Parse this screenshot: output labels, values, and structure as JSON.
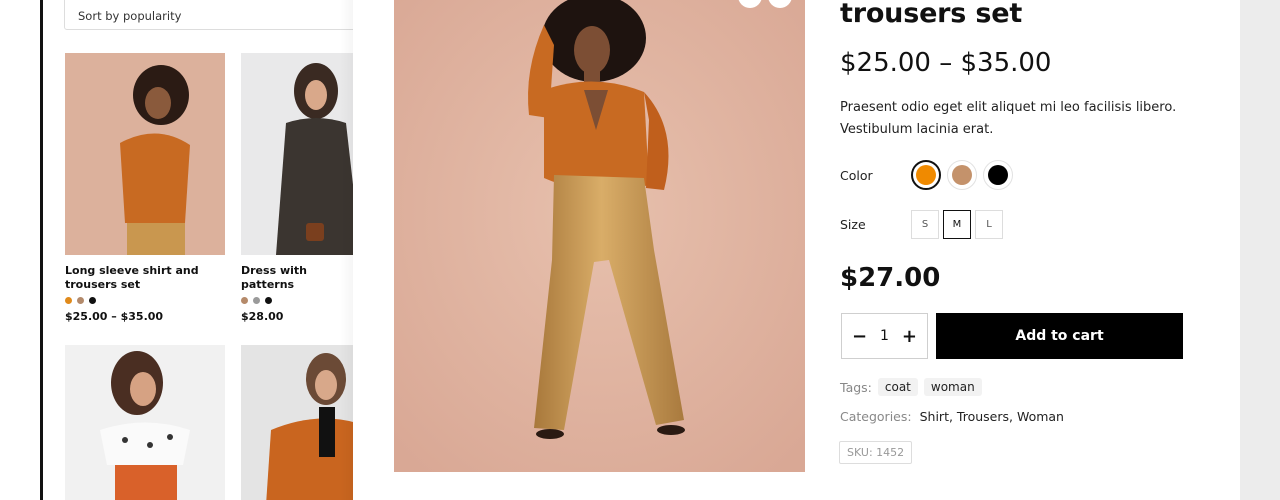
{
  "shop": {
    "sort_label": "Sort by popularity",
    "products": [
      {
        "name": "Long sleeve shirt and trousers set",
        "price": "$25.00 – $35.00",
        "swatches": [
          "#e08a1b",
          "#b38a6b",
          "#111111"
        ]
      },
      {
        "name": "Dress with patterns",
        "price": "$28.00",
        "swatches": [
          "#b58a6a",
          "#9a9a9a",
          "#111111"
        ]
      }
    ]
  },
  "quickview": {
    "title": "trousers set",
    "price_range": "$25.00 – $35.00",
    "description": "Praesent odio eget elit aliquet mi leo facilisis libero. Vestibulum lacinia erat.",
    "color_label": "Color",
    "colors": [
      {
        "name": "orange",
        "hex": "#f08a00",
        "selected": true
      },
      {
        "name": "tan",
        "hex": "#c4926b",
        "selected": false
      },
      {
        "name": "black",
        "hex": "#000000",
        "selected": false
      }
    ],
    "size_label": "Size",
    "sizes": [
      {
        "label": "S",
        "selected": false
      },
      {
        "label": "M",
        "selected": true
      },
      {
        "label": "L",
        "selected": false
      }
    ],
    "price": "$27.00",
    "quantity": "1",
    "minus": "−",
    "plus": "+",
    "add_to_cart": "Add to cart",
    "tags_label": "Tags:",
    "tags": [
      "coat",
      "woman"
    ],
    "categories_label": "Categories:",
    "categories": "Shirt, Trousers, Woman",
    "sku": "SKU:  1452"
  },
  "colors": {
    "image_bg": "#e3b8a4",
    "shirt": "#c86a22",
    "trousers": "#c9974f",
    "button": "#000000"
  }
}
